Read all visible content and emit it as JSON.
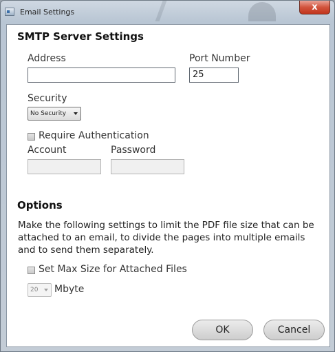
{
  "window": {
    "title": "Email Settings",
    "close_glyph": "x"
  },
  "smtp": {
    "heading": "SMTP Server Settings",
    "address_label": "Address",
    "address_value": "",
    "port_label": "Port Number",
    "port_value": "25",
    "security_label": "Security",
    "security_value": "No Security",
    "require_auth_label": "Require Authentication",
    "require_auth_checked": false,
    "account_label": "Account",
    "account_value": "",
    "password_label": "Password",
    "password_value": ""
  },
  "options": {
    "heading": "Options",
    "description": "Make the following settings to limit the PDF file size that can be attached to an email, to divide the pages into multiple emails and to send them separately.",
    "max_size_label": "Set Max Size for Attached Files",
    "max_size_checked": false,
    "max_size_value": "20",
    "unit_label": "Mbyte"
  },
  "buttons": {
    "ok": "OK",
    "cancel": "Cancel"
  },
  "icons": {
    "window": "email-settings-icon",
    "close": "close-icon",
    "dropdown": "chevron-down-icon"
  }
}
